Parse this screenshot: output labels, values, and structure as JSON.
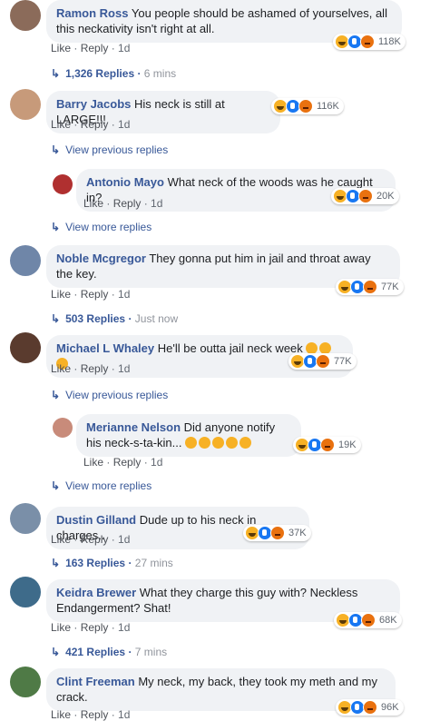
{
  "labels": {
    "like": "Like",
    "reply": "Reply",
    "sep": " · "
  },
  "comments": [
    {
      "name": "Ramon Ross",
      "text": "You people should be ashamed of yourselves, all this neckativity isn't right at all.",
      "time": "1d",
      "reactions": "118K"
    },
    {
      "replies": "1,326 Replies",
      "time": "6 mins"
    },
    {
      "name": "Barry Jacobs",
      "text": "His neck is still at LARGE!!!",
      "time": "1d",
      "reactions": "116K"
    },
    {
      "view": "View previous replies"
    },
    {
      "name": "Antonio Mayo",
      "text": "What neck of the woods was he caught in?",
      "time": "1d",
      "reactions": "20K"
    },
    {
      "view": "View more replies"
    },
    {
      "name": "Noble Mcgregor",
      "text": "They gonna put him in jail and throat away the key.",
      "time": "1d",
      "reactions": "77K"
    },
    {
      "replies": "503 Replies",
      "time": "Just now"
    },
    {
      "name": "Michael L Whaley",
      "text": "He'll be outta jail neck week",
      "time": "1d",
      "reactions": "77K"
    },
    {
      "view": "View previous replies"
    },
    {
      "name": "Merianne Nelson",
      "text": "Did anyone notify his neck-s-ta-kin...",
      "time": "1d",
      "reactions": "19K"
    },
    {
      "view": "View more replies"
    },
    {
      "name": "Dustin Gilland",
      "text": "Dude up to his neck in charges..",
      "time": "1d",
      "reactions": "37K"
    },
    {
      "replies": "163 Replies",
      "time": "27 mins"
    },
    {
      "name": "Keidra Brewer",
      "text": "What they charge this guy with? Neckless Endangerment? Shat!",
      "time": "1d",
      "reactions": "68K"
    },
    {
      "replies": "421 Replies",
      "time": "7 mins"
    },
    {
      "name": "Clint Freeman",
      "text": "My neck, my back, they took my meth and my crack.",
      "time": "1d",
      "reactions": "96K"
    }
  ],
  "colors": {
    "link": "#385898",
    "bubble": "#f0f2f5",
    "muted": "#90949c"
  }
}
